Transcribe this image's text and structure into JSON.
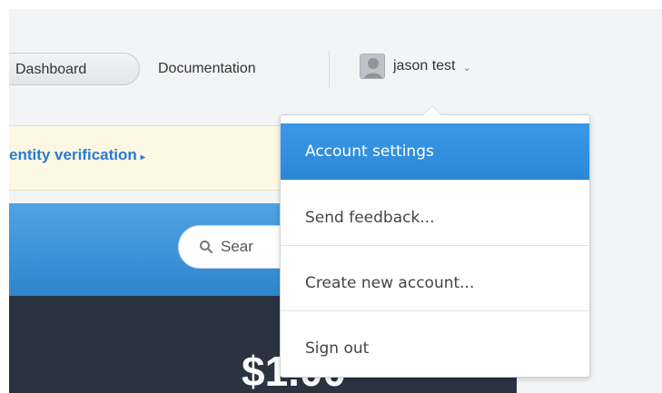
{
  "nav": {
    "dashboard": "Dashboard",
    "documentation": "Documentation",
    "user_name": "jason test",
    "chevron": "⌄"
  },
  "banner": {
    "text": "entity verification",
    "caret": "▸"
  },
  "search": {
    "placeholder": "Sear"
  },
  "balance": {
    "amount": "$1.00"
  },
  "account_menu": {
    "items": [
      {
        "label": "Account settings",
        "active": true
      },
      {
        "label": "Send feedback..."
      },
      {
        "label": "Create new account..."
      },
      {
        "label": "Sign out"
      }
    ]
  },
  "colors": {
    "accent": "#2f8ddb",
    "banner_bg": "#fcf8e3",
    "dark_panel": "#2b3341"
  }
}
